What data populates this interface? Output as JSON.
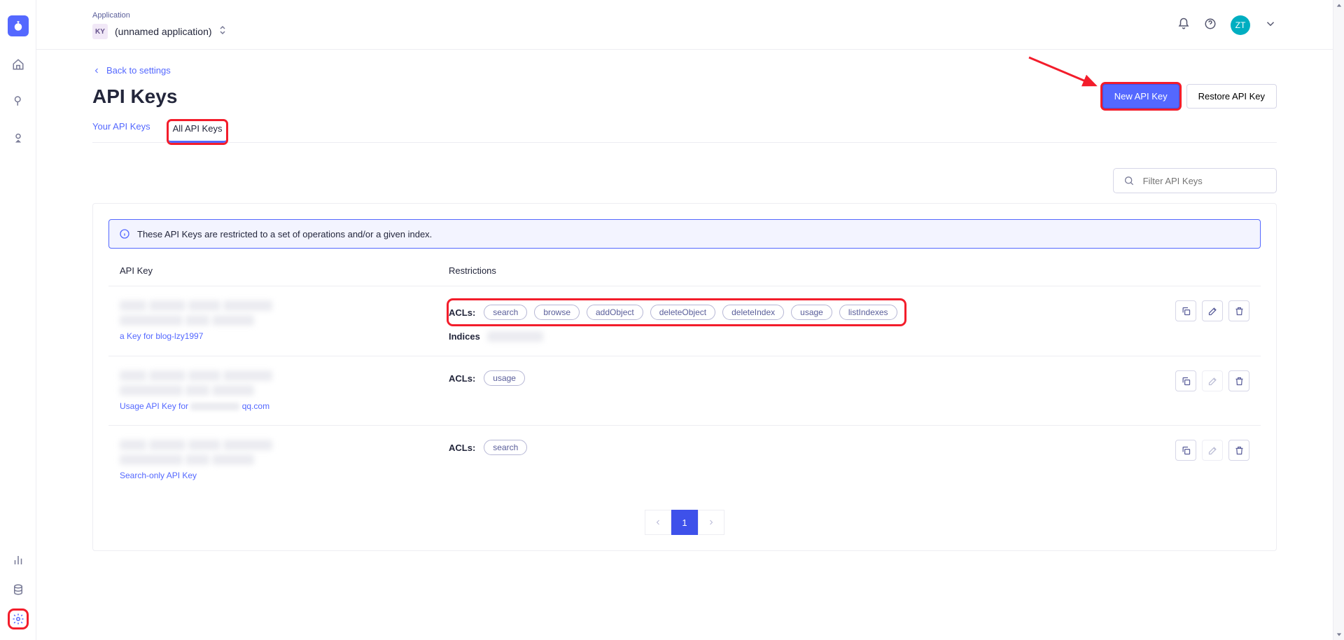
{
  "header": {
    "app_label": "Application",
    "app_chip": "KY",
    "app_name": "(unnamed application)",
    "avatar": "ZT"
  },
  "back_link": "Back to settings",
  "page_title": "API Keys",
  "buttons": {
    "new_key": "New API Key",
    "restore": "Restore API Key"
  },
  "tabs": {
    "yours": "Your API Keys",
    "all": "All API Keys"
  },
  "filter_placeholder": "Filter API Keys",
  "banner": "These API Keys are restricted to a set of operations and/or a given index.",
  "columns": {
    "key": "API Key",
    "restrictions": "Restrictions"
  },
  "acls_label": "ACLs:",
  "indices_label": "Indices",
  "rows": [
    {
      "desc_prefix": "a Key for blog-lzy1997",
      "acls": [
        "search",
        "browse",
        "addObject",
        "deleteObject",
        "deleteIndex",
        "usage",
        "listIndexes"
      ],
      "show_indices": true,
      "acl_highlight": true,
      "actions_disabled": false
    },
    {
      "desc_prefix": "Usage API Key for",
      "desc_suffix": "qq.com",
      "acls": [
        "usage"
      ],
      "show_indices": false,
      "acl_highlight": false,
      "actions_disabled": true
    },
    {
      "desc_prefix": "Search-only API Key",
      "acls": [
        "search"
      ],
      "show_indices": false,
      "acl_highlight": false,
      "actions_disabled": true
    }
  ],
  "pagination": {
    "current": "1"
  }
}
